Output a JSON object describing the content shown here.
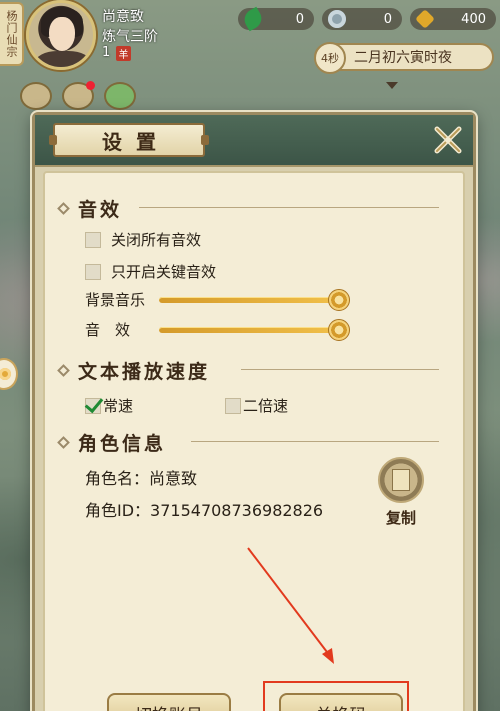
{
  "hud": {
    "sect": "杨门仙宗",
    "player_name": "尚意致",
    "player_rank": "炼气三阶",
    "player_level": "1",
    "level_badge": "羊",
    "jade": "0",
    "spirit_stone": "0",
    "gold": "400",
    "timer": "4秒",
    "game_time": "二月初六寅时夜"
  },
  "dialog": {
    "title": "设置",
    "sections": {
      "sound": {
        "title": "音效",
        "mute_all": "关闭所有音效",
        "key_only": "只开启关键音效",
        "bgm_label": "背景音乐",
        "bgm_level": 1.0,
        "sfx_label": "音　效",
        "sfx_level": 1.0
      },
      "text_speed": {
        "title": "文本播放速度",
        "normal": "常速",
        "double": "二倍速",
        "selected": "常速"
      },
      "role": {
        "title": "角色信息",
        "name_line": "角色名：尚意致",
        "id_line": "角色ID：37154708736982826",
        "copy_label": "复制"
      }
    },
    "buttons": {
      "switch_account": "切换账号",
      "redeem_code": "兑换码"
    }
  },
  "colors": {
    "annotation": "#e23a1e",
    "check": "#1f8a34",
    "slider": "#e0a82a"
  }
}
